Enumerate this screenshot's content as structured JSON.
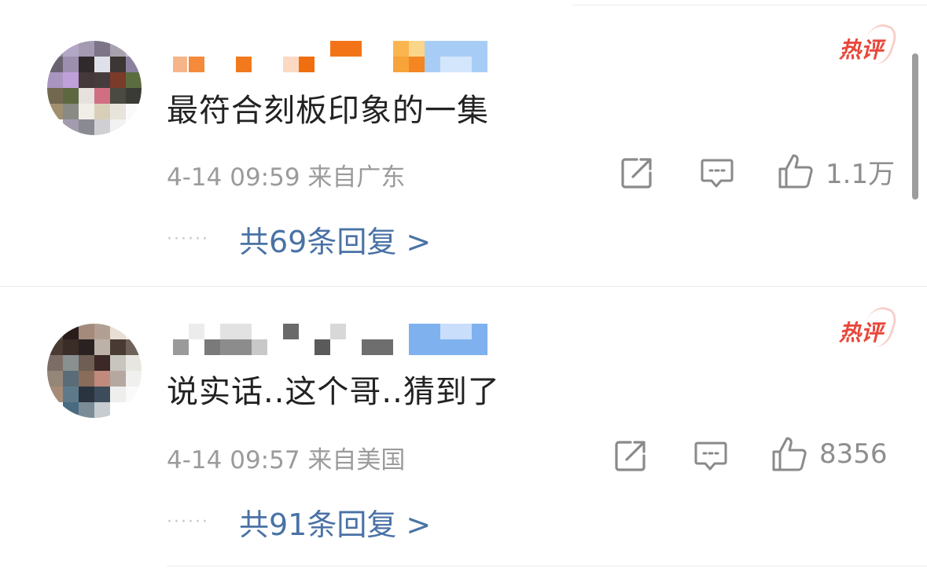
{
  "comments": [
    {
      "badge": "热评",
      "text": "最符合刻板印象的一集",
      "date": "4-14",
      "time": "09:59",
      "location": "来自广东",
      "likes": "1.1万",
      "reply_summary": "共69条回复 >",
      "actions": {
        "share_icon": "share-square-icon",
        "comment_icon": "comment-bubble-icon",
        "like_icon": "thumbs-up-icon"
      }
    },
    {
      "badge": "热评",
      "text": "说实话..这个哥..猜到了",
      "date": "4-14",
      "time": "09:57",
      "location": "来自美国",
      "likes": "8356",
      "reply_summary": "共91条回复 >",
      "actions": {
        "share_icon": "share-square-icon",
        "comment_icon": "comment-bubble-icon",
        "like_icon": "thumbs-up-icon"
      }
    }
  ],
  "colors": {
    "text": "#222222",
    "meta": "#9b9b9b",
    "link": "#4a72a5",
    "hot_badge": "#e8473a",
    "icon": "#8a8a8a"
  }
}
